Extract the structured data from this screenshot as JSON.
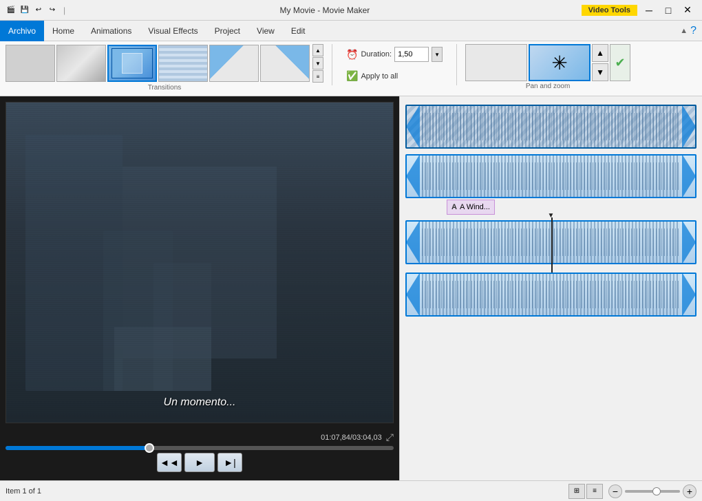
{
  "titleBar": {
    "appName": "My Movie - Movie Maker",
    "videoToolsBadge": "Video Tools",
    "icons": [
      "💾",
      "↩",
      "↪"
    ],
    "controls": [
      "─",
      "□",
      "✕"
    ]
  },
  "menuBar": {
    "items": [
      {
        "id": "archivo",
        "label": "Archivo",
        "active": true
      },
      {
        "id": "home",
        "label": "Home",
        "active": false
      },
      {
        "id": "animations",
        "label": "Animations",
        "active": false
      },
      {
        "id": "visual-effects",
        "label": "Visual Effects",
        "active": false
      },
      {
        "id": "project",
        "label": "Project",
        "active": false
      },
      {
        "id": "view",
        "label": "View",
        "active": false
      },
      {
        "id": "edit",
        "label": "Edit",
        "active": false
      }
    ]
  },
  "ribbon": {
    "transitions": {
      "sectionLabel": "Transitions",
      "items": [
        {
          "id": "blank1",
          "type": "blank"
        },
        {
          "id": "fade",
          "type": "fade"
        },
        {
          "id": "selected-blue",
          "type": "selected",
          "selected": true
        },
        {
          "id": "mosaic",
          "type": "mosaic"
        },
        {
          "id": "wipe-l",
          "type": "wipe-l"
        },
        {
          "id": "wipe-r",
          "type": "wipe-r"
        }
      ]
    },
    "duration": {
      "label": "Duration:",
      "value": "1,50",
      "clockIcon": "🕐"
    },
    "applyAll": {
      "label": "Apply to all",
      "checkIcon": "✓"
    },
    "panZoom": {
      "sectionLabel": "Pan and zoom",
      "items": [
        {
          "id": "pz-blank",
          "type": "blank"
        },
        {
          "id": "pz-selected",
          "type": "selected"
        },
        {
          "id": "pz-blank2",
          "type": "blank"
        }
      ]
    }
  },
  "videoPreview": {
    "subtitle": "Un momento...",
    "timeDisplay": "01:07,84/03:04,03",
    "progressPercent": 37
  },
  "videoControls": {
    "rewind": "◄◄",
    "play": "►",
    "forward": "►|"
  },
  "timeline": {
    "clips": [
      {
        "id": "clip1",
        "type": "diagonal",
        "selected": true
      },
      {
        "id": "clip2",
        "type": "normal"
      },
      {
        "id": "clip3",
        "type": "normal",
        "hasPlayhead": true
      },
      {
        "id": "clip4",
        "type": "normal"
      }
    ],
    "textClip": {
      "label": "A Wind..."
    }
  },
  "statusBar": {
    "itemInfo": "Item 1 of 1"
  }
}
